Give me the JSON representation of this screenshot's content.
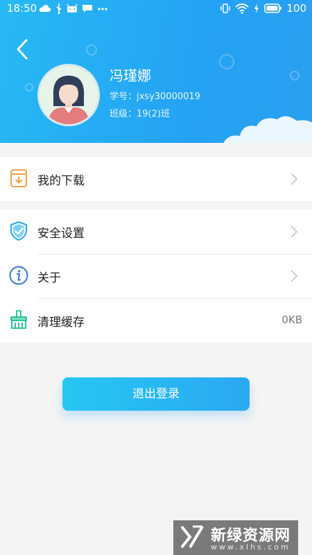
{
  "status_bar": {
    "time": "18:50",
    "battery": "100",
    "left_icons": [
      "cloud-icon",
      "usb-icon",
      "android-icon",
      "message-icon",
      "more-icon"
    ],
    "right_icons": [
      "vibrate-icon",
      "wifi-icon",
      "charging-icon",
      "battery-icon"
    ]
  },
  "header": {
    "back_icon": "back-arrow-icon",
    "name": "冯瑾娜",
    "student_id": "学号：jxsy30000019",
    "class_info": "班级：19(2)班"
  },
  "menu_group_1": [
    {
      "label": "我的下载",
      "icon": "download-book-icon",
      "icon_color": "#f0a24a"
    }
  ],
  "menu_group_2": [
    {
      "label": "安全设置",
      "icon": "shield-check-icon",
      "icon_color": "#2aa6e8"
    },
    {
      "label": "关于",
      "icon": "info-icon",
      "icon_color": "#4a7fd6"
    },
    {
      "label": "清理缓存",
      "icon": "broom-icon",
      "icon_color": "#2bc39a",
      "value": "0KB"
    }
  ],
  "logout": {
    "label": "退出登录"
  },
  "watermark": {
    "title": "新绿资源网",
    "sub": "www.xlhs.com"
  },
  "colors": {
    "header_blue": "#24a3f3",
    "accent": "#2aa8f3",
    "background": "#f4f4f4"
  }
}
